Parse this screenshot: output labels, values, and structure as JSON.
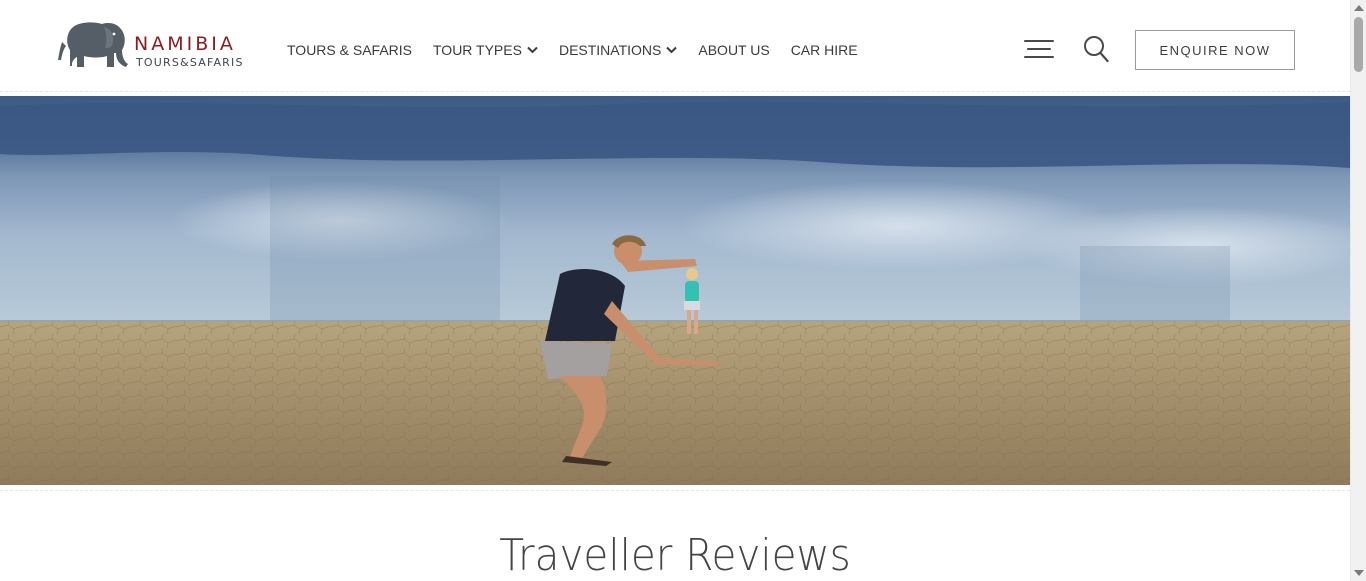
{
  "brand": {
    "name": "NAMIBIA",
    "tagline": "TOURS&SAFARIS",
    "logo_icon": "elephant-icon",
    "colors": {
      "name": "#8c1d1d",
      "tagline": "#3e4650",
      "elephant": "#555d66"
    }
  },
  "nav": {
    "items": [
      {
        "label": "TOURS & SAFARIS",
        "has_dropdown": false
      },
      {
        "label": "TOUR TYPES",
        "has_dropdown": true
      },
      {
        "label": "DESTINATIONS",
        "has_dropdown": true
      },
      {
        "label": "ABOUT US",
        "has_dropdown": false
      },
      {
        "label": "CAR HIRE",
        "has_dropdown": false
      }
    ]
  },
  "header_actions": {
    "menu_icon": "hamburger-menu-icon",
    "search_icon": "search-icon",
    "enquire_label": "ENQUIRE NOW"
  },
  "hero": {
    "image": "salt-pan-photo"
  },
  "section": {
    "title": "Traveller Reviews"
  }
}
